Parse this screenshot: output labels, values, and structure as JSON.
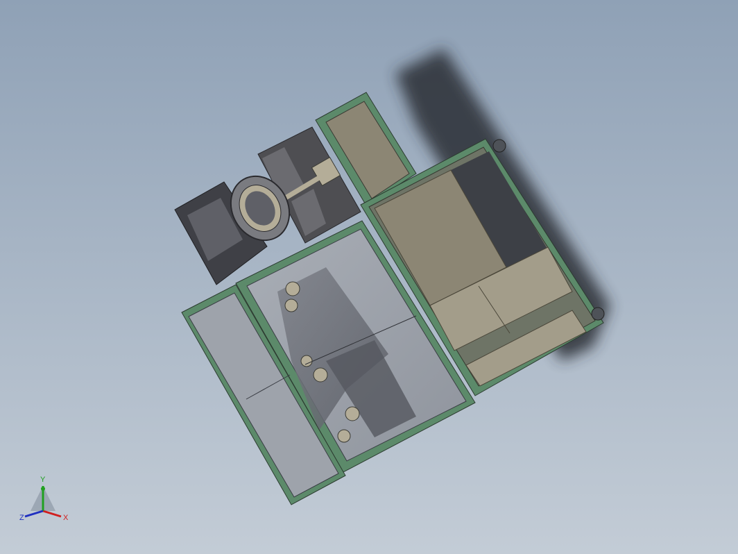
{
  "viewport": {
    "background_top": "#8fa1b6",
    "background_bottom": "#c3ccd6"
  },
  "model": {
    "frame_color": "#5c8a6a",
    "panel_color": "#8c8674",
    "panel_light_color": "#a39d8a",
    "glass_color": "#9ea3ab",
    "dark_part_color": "#4e4e52",
    "shadow_color": "#2c2f36"
  },
  "triad": {
    "x_label": "X",
    "y_label": "Y",
    "z_label": "Z",
    "x_color": "#d02020",
    "y_color": "#20a020",
    "z_color": "#2030c0"
  }
}
